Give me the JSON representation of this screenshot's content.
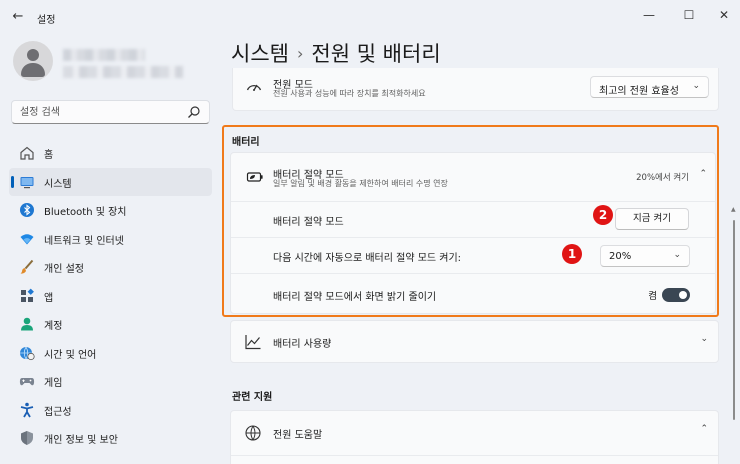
{
  "app": {
    "title": "설정"
  },
  "window": {
    "back": "←",
    "minimize": "—",
    "maximize": "☐",
    "close": "✕"
  },
  "search": {
    "placeholder": "설정 검색"
  },
  "nav": {
    "items": [
      {
        "label": "홈",
        "icon": "home-icon"
      },
      {
        "label": "시스템",
        "icon": "system-icon",
        "active": true
      },
      {
        "label": "Bluetooth 및 장치",
        "icon": "bluetooth-icon"
      },
      {
        "label": "네트워크 및 인터넷",
        "icon": "wifi-icon"
      },
      {
        "label": "개인 설정",
        "icon": "brush-icon"
      },
      {
        "label": "앱",
        "icon": "apps-icon"
      },
      {
        "label": "계정",
        "icon": "account-icon"
      },
      {
        "label": "시간 및 언어",
        "icon": "globe-clock-icon"
      },
      {
        "label": "게임",
        "icon": "gamepad-icon"
      },
      {
        "label": "접근성",
        "icon": "accessibility-icon"
      },
      {
        "label": "개인 정보 및 보안",
        "icon": "shield-icon"
      }
    ]
  },
  "breadcrumb": {
    "parent": "시스템",
    "separator": "›",
    "current": "전원 및 배터리"
  },
  "power_mode": {
    "title": "전원 모드",
    "description": "전원 사용과 성능에 따라 장치를 최적화하세요",
    "value": "최고의 전원 효율성"
  },
  "battery_section": {
    "heading": "배터리",
    "saver": {
      "title": "배터리 절약 모드",
      "description": "일부 알림 및 배경 활동을 제한하여 배터리 수명 연장",
      "status": "20%에서 켜기",
      "row_now_label": "배터리 절약 모드",
      "button_now": "지금 켜기",
      "row_auto_label": "다음 시간에 자동으로 배터리 절약 모드 켜기:",
      "auto_value": "20%",
      "row_brightness_label": "배터리 절약 모드에서 화면 밝기 줄이기",
      "brightness_state": "켬",
      "brightness_on": true
    },
    "usage": {
      "title": "배터리 사용량"
    }
  },
  "related": {
    "heading": "관련 지원",
    "help_title": "전원 도움말"
  },
  "annotations": {
    "badge1": "1",
    "badge2": "2"
  },
  "colors": {
    "accent": "#005fb8",
    "highlight": "#f07a1a",
    "badge": "#e01414"
  }
}
